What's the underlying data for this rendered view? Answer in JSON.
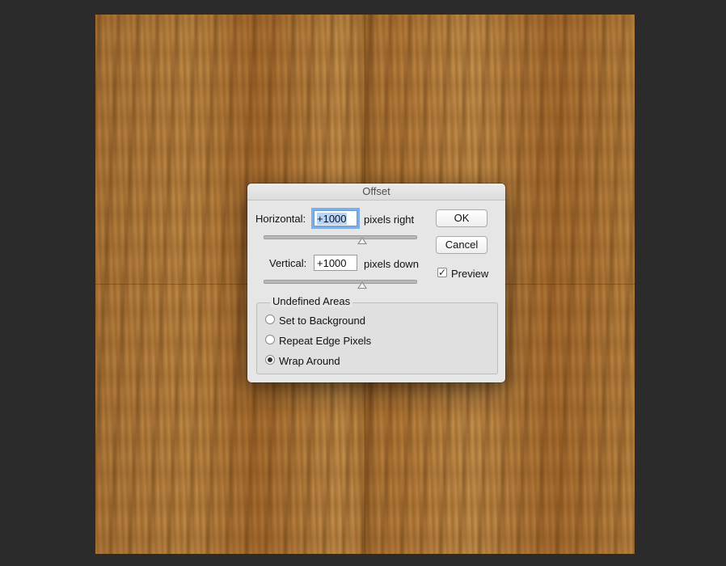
{
  "dialog": {
    "title": "Offset",
    "horizontal": {
      "label": "Horizontal:",
      "value": "+1000",
      "unit": "pixels right",
      "slider_fraction": 0.65
    },
    "vertical": {
      "label": "Vertical:",
      "value": "+1000",
      "unit": "pixels down",
      "slider_fraction": 0.65
    },
    "ok_label": "OK",
    "cancel_label": "Cancel",
    "preview": {
      "label": "Preview",
      "checked": true
    },
    "undefined_areas": {
      "title": "Undefined Areas",
      "options": [
        {
          "label": "Set to Background",
          "selected": false
        },
        {
          "label": "Repeat Edge Pixels",
          "selected": false
        },
        {
          "label": "Wrap Around",
          "selected": true
        }
      ]
    }
  }
}
